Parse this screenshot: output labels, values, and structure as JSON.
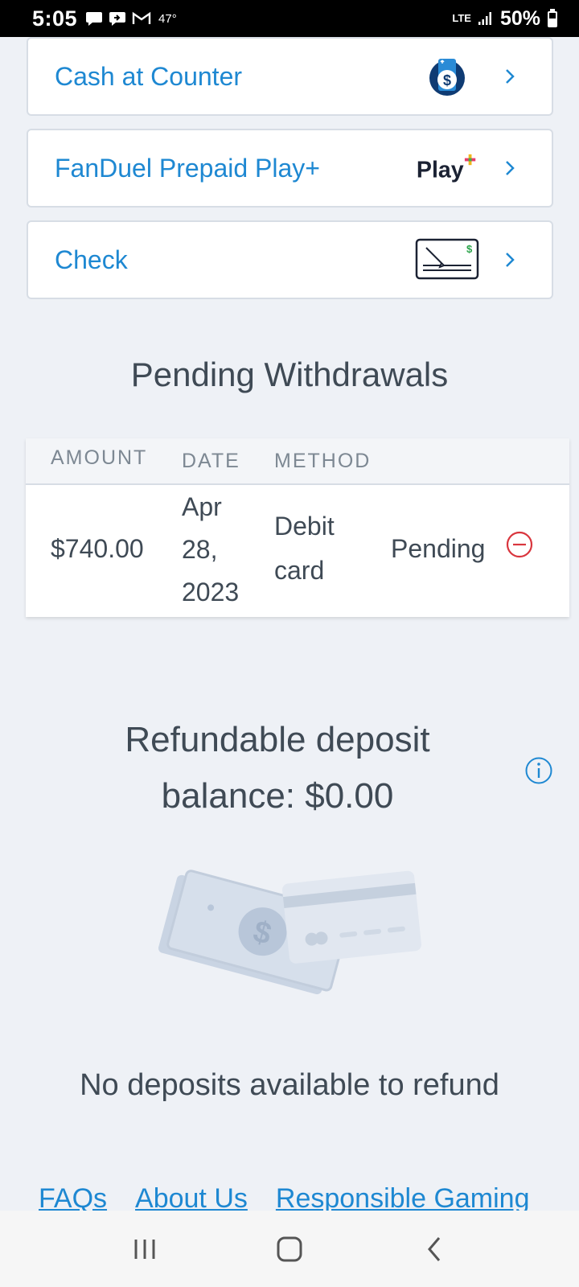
{
  "status_bar": {
    "time": "5:05",
    "temperature": "47°",
    "network": "LTE",
    "battery": "50%"
  },
  "methods": [
    {
      "label": "Cash at Counter",
      "logo": "cash-at-counter-logo"
    },
    {
      "label": "FanDuel Prepaid Play+",
      "logo_text": "Play"
    },
    {
      "label": "Check",
      "logo": "check-logo"
    }
  ],
  "pending": {
    "title": "Pending Withdrawals",
    "columns": [
      "AMOUNT",
      "DATE",
      "METHOD"
    ],
    "rows": [
      {
        "amount": "$740.00",
        "date_line1": "Apr",
        "date_line2": "28,",
        "date_line3": "2023",
        "method_line1": "Debit",
        "method_line2": "card",
        "status": "Pending"
      }
    ]
  },
  "refund": {
    "title_line1": "Refundable deposit",
    "title_line2": "balance: $0.00",
    "empty_message": "No deposits available to refund"
  },
  "footer": {
    "links": [
      "FAQs",
      "About Us",
      "Responsible Gaming"
    ]
  },
  "colors": {
    "accent": "#1e88d2",
    "background": "#eef1f6",
    "danger": "#d9363e"
  }
}
